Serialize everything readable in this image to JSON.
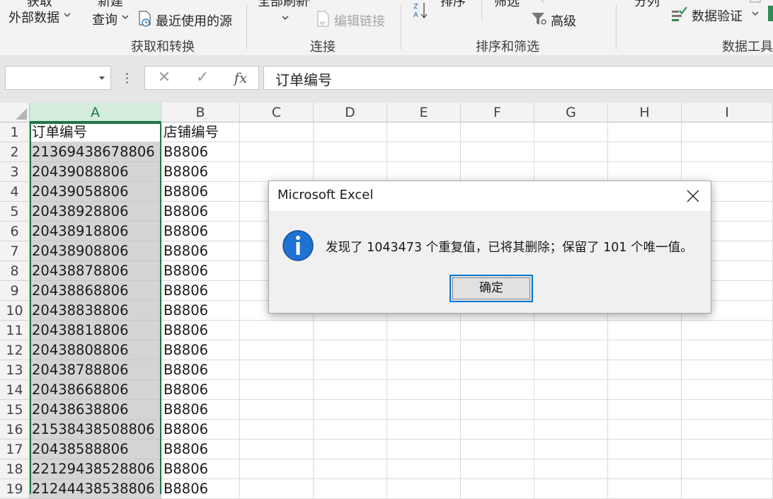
{
  "ribbon": {
    "get_data_top": "获取",
    "get_data_bottom": "外部数据",
    "new_query_top": "新建",
    "new_query_bottom": "查询",
    "recent_sources": "最近使用的源",
    "group_get_transform": "获取和转换",
    "refresh_all": "全部刷新",
    "edit_links": "编辑链接",
    "group_connections": "连接",
    "sort": "排序",
    "filter": "筛选",
    "advanced": "高级",
    "group_sort_filter": "排序和筛选",
    "split_column": "分列",
    "data_validation": "数据验证",
    "group_data_tools": "数据工具"
  },
  "formula_bar": {
    "name_box": "",
    "cancel_icon": "✕",
    "enter_icon": "✓",
    "fx_label": "fx",
    "content": "订单编号"
  },
  "columns": [
    "A",
    "B",
    "C",
    "D",
    "E",
    "F",
    "G",
    "H",
    "I"
  ],
  "rows": [
    {
      "n": "1",
      "a": "订单编号",
      "b": "店铺编号"
    },
    {
      "n": "2",
      "a": "21369438678806",
      "b": "B8806"
    },
    {
      "n": "3",
      "a": "20439088806",
      "b": "B8806"
    },
    {
      "n": "4",
      "a": "20439058806",
      "b": "B8806"
    },
    {
      "n": "5",
      "a": "20438928806",
      "b": "B8806"
    },
    {
      "n": "6",
      "a": "20438918806",
      "b": "B8806"
    },
    {
      "n": "7",
      "a": "20438908806",
      "b": "B8806"
    },
    {
      "n": "8",
      "a": "20438878806",
      "b": "B8806"
    },
    {
      "n": "9",
      "a": "20438868806",
      "b": "B8806"
    },
    {
      "n": "10",
      "a": "20438838806",
      "b": "B8806"
    },
    {
      "n": "11",
      "a": "20438818806",
      "b": "B8806"
    },
    {
      "n": "12",
      "a": "20438808806",
      "b": "B8806"
    },
    {
      "n": "13",
      "a": "20438788806",
      "b": "B8806"
    },
    {
      "n": "14",
      "a": "20438668806",
      "b": "B8806"
    },
    {
      "n": "15",
      "a": "20438638806",
      "b": "B8806"
    },
    {
      "n": "16",
      "a": "21538438508806",
      "b": "B8806"
    },
    {
      "n": "17",
      "a": "20438588806",
      "b": "B8806"
    },
    {
      "n": "18",
      "a": "22129438528806",
      "b": "B8806"
    },
    {
      "n": "19",
      "a": "21244438538806",
      "b": "B8806"
    }
  ],
  "dialog": {
    "title": "Microsoft Excel",
    "message": "发现了 1043473 个重复值，已将其删除；保留了 101 个唯一值。",
    "ok_label": "确定",
    "close_icon": "close-icon",
    "info_icon": "info-icon"
  },
  "colors": {
    "selection_green": "#217346",
    "dialog_button_border": "#0078d7",
    "info_icon_blue": "#1e72d2"
  }
}
